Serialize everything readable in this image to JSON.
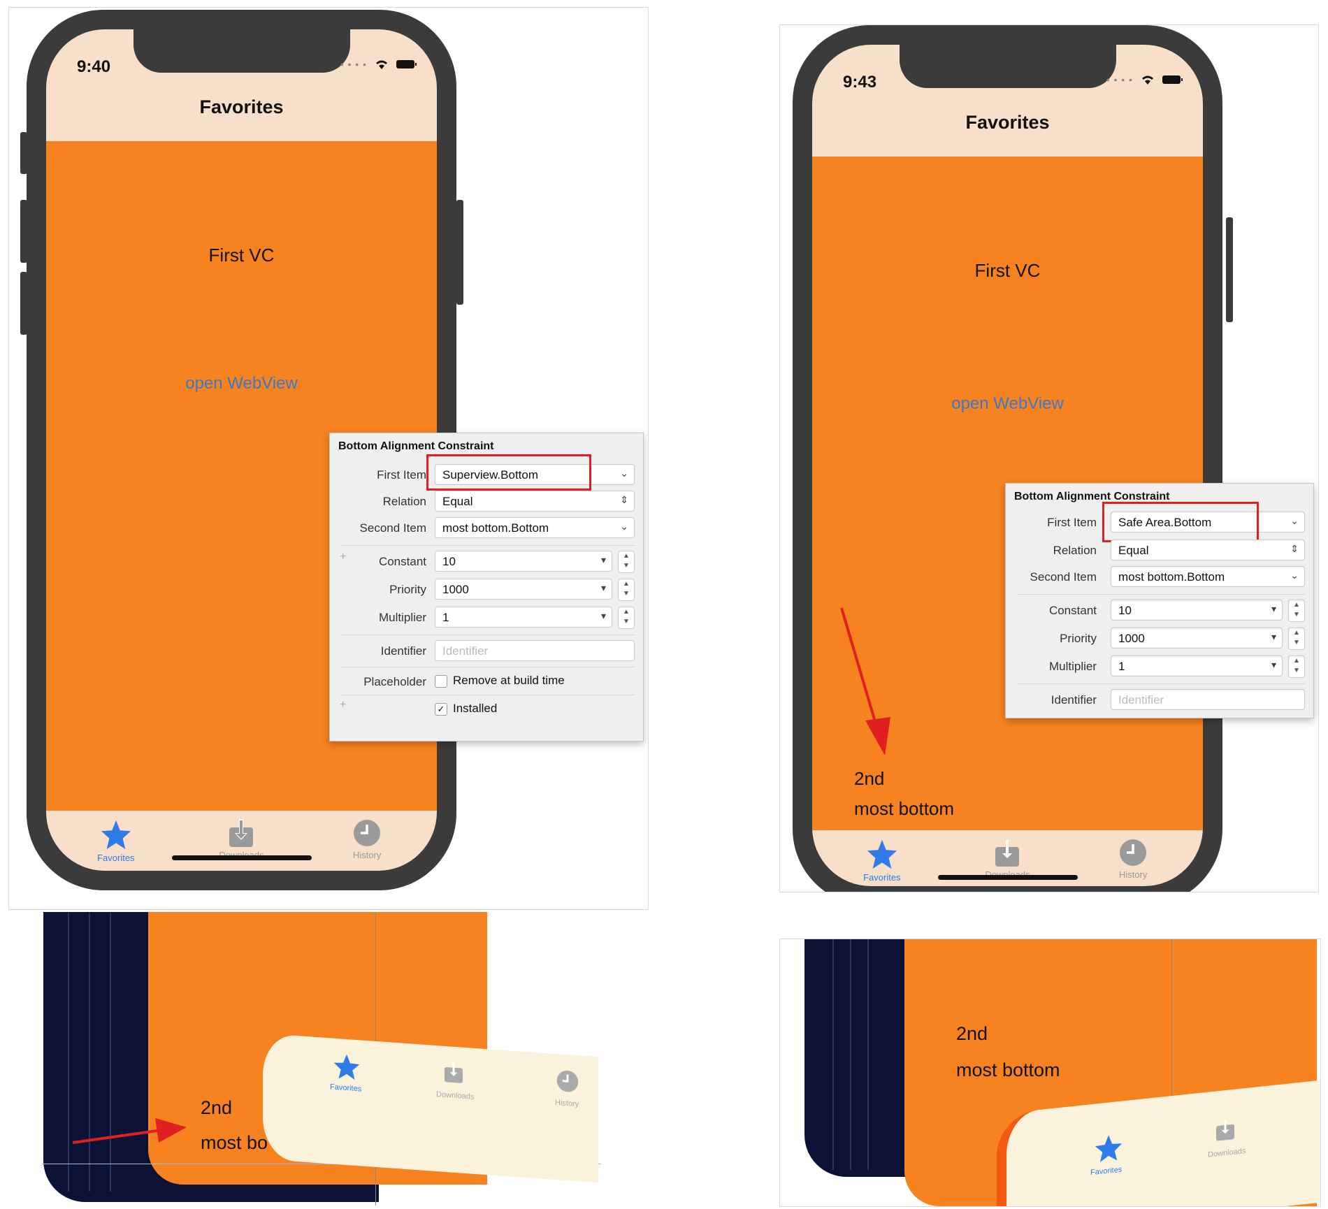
{
  "left_simulator": {
    "time": "9:40",
    "nav_title": "Favorites",
    "vc_label": "First VC",
    "link": "open WebView",
    "tabs": [
      {
        "label": "Favorites",
        "icon": "star-icon",
        "active": true
      },
      {
        "label": "Downloads",
        "icon": "download-icon",
        "active": false
      },
      {
        "label": "History",
        "icon": "clock-icon",
        "active": false
      }
    ]
  },
  "left_inspector": {
    "title": "Bottom Alignment Constraint",
    "first_item_label": "First Item",
    "first_item_value": "Superview.Bottom",
    "relation_label": "Relation",
    "relation_value": "Equal",
    "second_item_label": "Second Item",
    "second_item_value": "most bottom.Bottom",
    "constant_label": "Constant",
    "constant_value": "10",
    "priority_label": "Priority",
    "priority_value": "1000",
    "multiplier_label": "Multiplier",
    "multiplier_value": "1",
    "identifier_label": "Identifier",
    "identifier_placeholder": "Identifier",
    "placeholder_label": "Placeholder",
    "remove_label": "Remove at build time",
    "remove_checked": false,
    "installed_label": "Installed",
    "installed_checked": true
  },
  "right_simulator": {
    "time": "9:43",
    "nav_title": "Favorites",
    "vc_label": "First VC",
    "link": "open WebView",
    "label_2nd": "2nd",
    "label_most_bottom": "most bottom",
    "tabs": [
      {
        "label": "Favorites",
        "icon": "star-icon",
        "active": true
      },
      {
        "label": "Downloads",
        "icon": "download-icon",
        "active": false
      },
      {
        "label": "History",
        "icon": "clock-icon",
        "active": false
      }
    ]
  },
  "right_inspector": {
    "title": "Bottom Alignment Constraint",
    "first_item_label": "First Item",
    "first_item_value": "Safe Area.Bottom",
    "relation_label": "Relation",
    "relation_value": "Equal",
    "second_item_label": "Second Item",
    "second_item_value": "most bottom.Bottom",
    "constant_label": "Constant",
    "constant_value": "10",
    "priority_label": "Priority",
    "priority_value": "1000",
    "multiplier_label": "Multiplier",
    "multiplier_value": "1",
    "identifier_label": "Identifier",
    "identifier_placeholder": "Identifier"
  },
  "left_3d": {
    "label_2nd": "2nd",
    "label_most_bottom": "most bo",
    "tab_favorites": "Favorites",
    "tab_downloads": "Downloads",
    "tab_history": "History"
  },
  "right_3d": {
    "label_2nd": "2nd",
    "label_most_bottom": "most bottom",
    "tab_favorites": "Favorites",
    "tab_downloads": "Downloads"
  },
  "colors": {
    "orange": "#f78220",
    "nav_bar": "#f7dfc9",
    "tint_blue": "#2f7be8",
    "highlight_red": "#e02020",
    "device_frame": "#3b3b3b",
    "debug_navy": "#0b1235"
  }
}
